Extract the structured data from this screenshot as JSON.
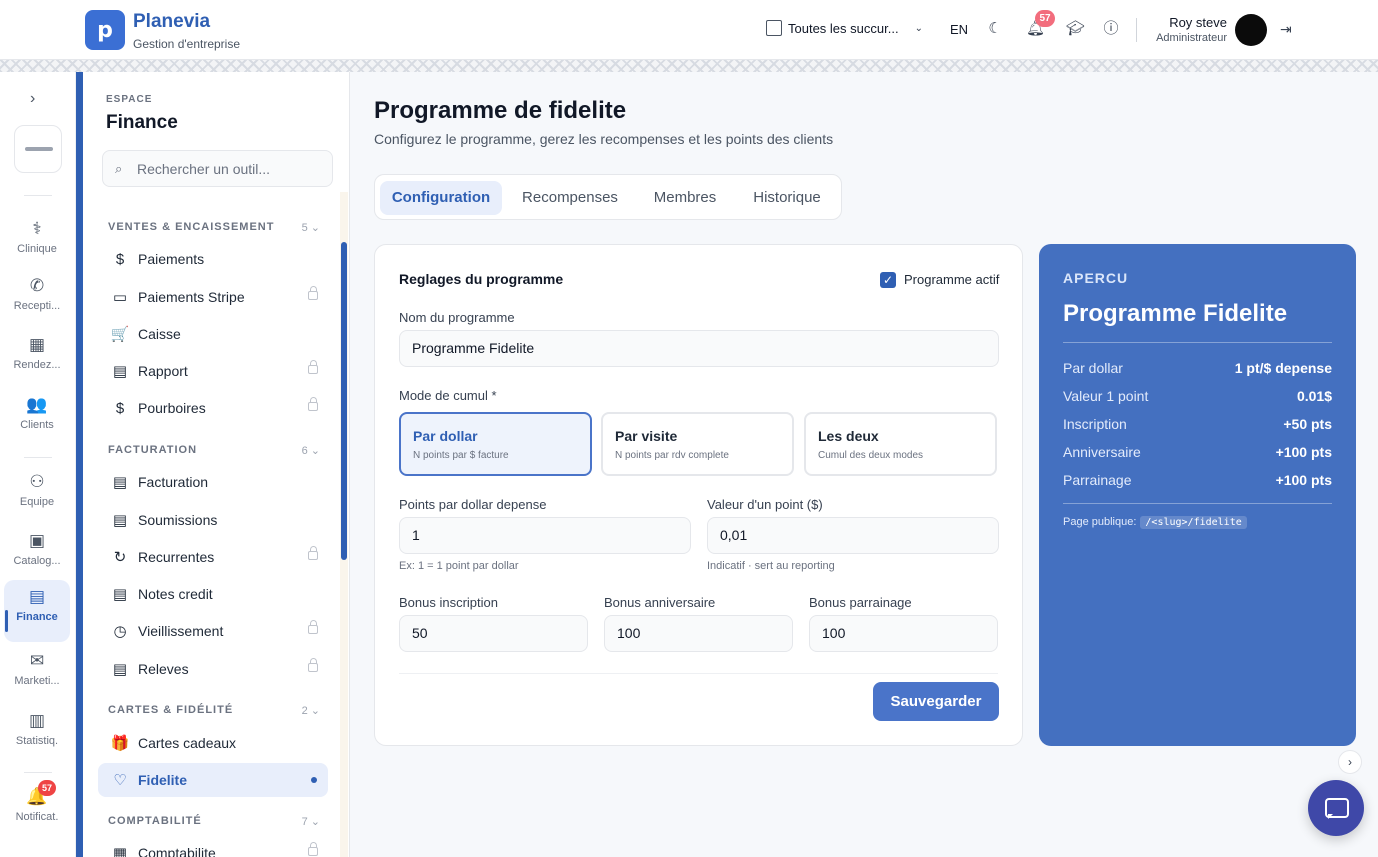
{
  "brand": {
    "name": "Planevia",
    "subtitle": "Gestion d'entreprise",
    "logo_letter": "p"
  },
  "topbar": {
    "branch": "Toutes les succur...",
    "lang": "EN",
    "notif_count": "57",
    "user_name": "Roy steve",
    "user_role": "Administrateur"
  },
  "rail": {
    "items": [
      {
        "label": "Clinique",
        "icon": "stethoscope-icon",
        "glyph": "⚕"
      },
      {
        "label": "Recepti...",
        "icon": "phone-icon",
        "glyph": "✆"
      },
      {
        "label": "Rendez...",
        "icon": "calendar-icon",
        "glyph": "▦"
      },
      {
        "label": "Clients",
        "icon": "users-icon",
        "glyph": "👥"
      },
      {
        "label": "Equipe",
        "icon": "team-icon",
        "glyph": "⚇"
      },
      {
        "label": "Catalog...",
        "icon": "briefcase-icon",
        "glyph": "▣"
      },
      {
        "label": "Finance",
        "icon": "wallet-icon",
        "glyph": "▤"
      },
      {
        "label": "Marketi...",
        "icon": "mail-icon",
        "glyph": "✉"
      },
      {
        "label": "Statistiq.",
        "icon": "bar-chart-icon",
        "glyph": "▥"
      },
      {
        "label": "Notificat.",
        "icon": "bell-icon",
        "glyph": "🔔"
      }
    ],
    "notif_badge": "57"
  },
  "panel": {
    "espace_label": "ESPACE",
    "title": "Finance",
    "search_placeholder": "Rechercher un outil...",
    "sections": [
      {
        "title": "VENTES & ENCAISSEMENT",
        "count": "5 ⌄"
      },
      {
        "title": "FACTURATION",
        "count": "6 ⌄"
      },
      {
        "title": "CARTES & FIDÉLITÉ",
        "count": "2 ⌄"
      },
      {
        "title": "COMPTABILITÉ",
        "count": "7 ⌄"
      }
    ],
    "items": [
      {
        "label": "Paiements",
        "glyph": "$"
      },
      {
        "label": "Paiements Stripe",
        "glyph": "▭"
      },
      {
        "label": "Caisse",
        "glyph": "🛒"
      },
      {
        "label": "Rapport",
        "glyph": "▤"
      },
      {
        "label": "Pourboires",
        "glyph": "$"
      },
      {
        "label": "Facturation",
        "glyph": "▤"
      },
      {
        "label": "Soumissions",
        "glyph": "▤"
      },
      {
        "label": "Recurrentes",
        "glyph": "↻"
      },
      {
        "label": "Notes credit",
        "glyph": "▤"
      },
      {
        "label": "Vieillissement",
        "glyph": "◷"
      },
      {
        "label": "Releves",
        "glyph": "▤"
      },
      {
        "label": "Cartes cadeaux",
        "glyph": "🎁"
      },
      {
        "label": "Fidelite",
        "glyph": "♡"
      },
      {
        "label": "Comptabilite",
        "glyph": "▦"
      }
    ]
  },
  "main": {
    "title": "Programme de fidelite",
    "subtitle": "Configurez le programme, gerez les recompenses et les points des clients",
    "tabs": [
      "Configuration",
      "Recompenses",
      "Membres",
      "Historique"
    ],
    "card": {
      "title": "Reglages du programme",
      "active_label": "Programme actif",
      "name_label": "Nom du programme",
      "name_value": "Programme Fidelite",
      "mode_label": "Mode de cumul *",
      "modes": [
        {
          "title": "Par dollar",
          "desc": "N points par $ facture"
        },
        {
          "title": "Par visite",
          "desc": "N points par rdv complete"
        },
        {
          "title": "Les deux",
          "desc": "Cumul des deux modes"
        }
      ],
      "points_label": "Points par dollar depense",
      "points_value": "1",
      "points_hint": "Ex: 1 = 1 point par dollar",
      "value_label": "Valeur d'un point ($)",
      "value_value": "0,01",
      "value_hint": "Indicatif · sert au reporting",
      "bonus_inscription_label": "Bonus inscription",
      "bonus_inscription_value": "50",
      "bonus_anniversaire_label": "Bonus anniversaire",
      "bonus_anniversaire_value": "100",
      "bonus_parrainage_label": "Bonus parrainage",
      "bonus_parrainage_value": "100",
      "save_label": "Sauvegarder"
    },
    "preview": {
      "label": "APERCU",
      "title": "Programme Fidelite",
      "rows": [
        {
          "k": "Par dollar",
          "v": "1 pt/$ depense"
        },
        {
          "k": "Valeur 1 point",
          "v": "0.01$"
        },
        {
          "k": "Inscription",
          "v": "+50 pts"
        },
        {
          "k": "Anniversaire",
          "v": "+100 pts"
        },
        {
          "k": "Parrainage",
          "v": "+100 pts"
        }
      ],
      "public_label": "Page publique:",
      "public_path": "/<slug>/fidelite"
    }
  }
}
